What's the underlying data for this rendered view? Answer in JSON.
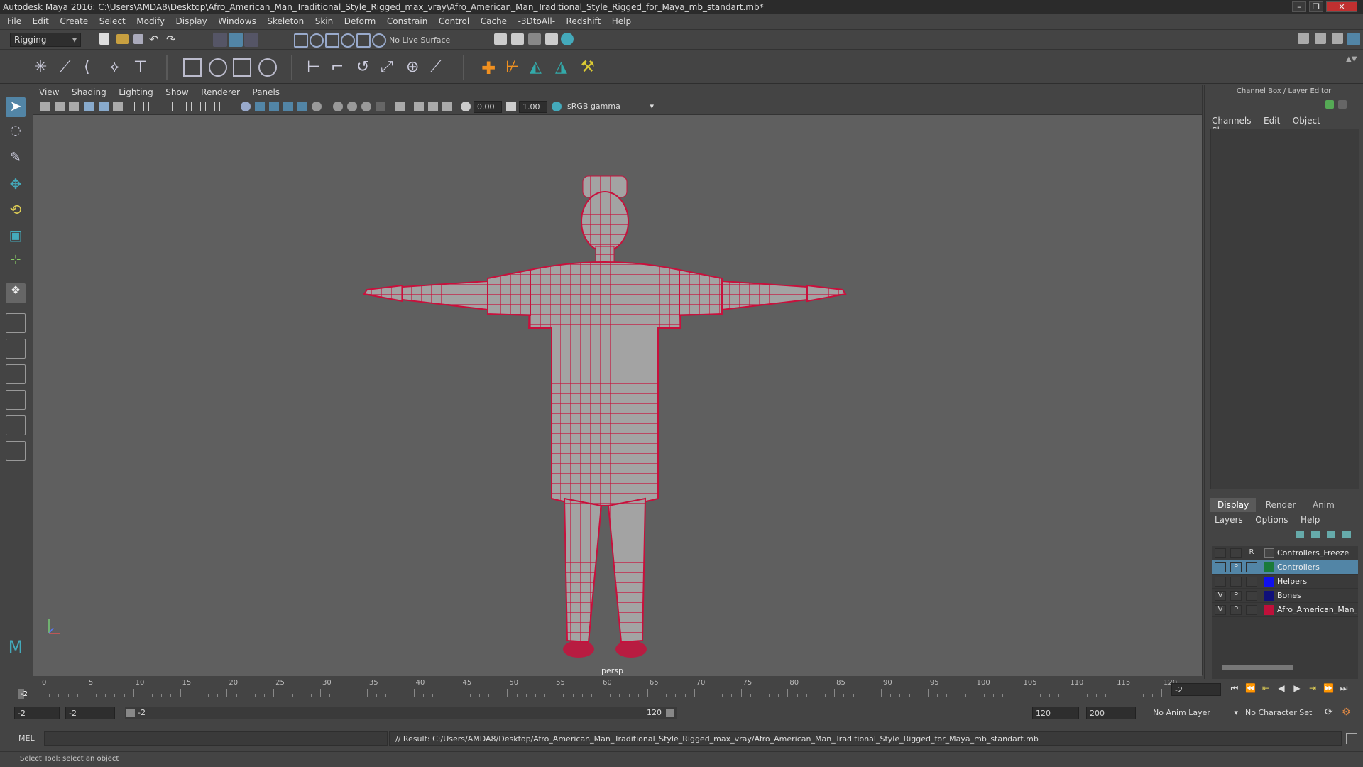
{
  "window": {
    "title": "Autodesk Maya 2016: C:\\Users\\AMDA8\\Desktop\\Afro_American_Man_Traditional_Style_Rigged_max_vray\\Afro_American_Man_Traditional_Style_Rigged_for_Maya_mb_standart.mb*",
    "controls": [
      "–",
      "❐",
      "✕"
    ]
  },
  "menubar": [
    "File",
    "Edit",
    "Create",
    "Select",
    "Modify",
    "Display",
    "Windows",
    "Skeleton",
    "Skin",
    "Deform",
    "Constrain",
    "Control",
    "Cache",
    "-3DtoAll-",
    "Redshift",
    "Help"
  ],
  "statusline": {
    "mode": "Rigging",
    "live_surface": "No Live Surface"
  },
  "viewport": {
    "menu": [
      "View",
      "Shading",
      "Lighting",
      "Show",
      "Renderer",
      "Panels"
    ],
    "exposure": "0.00",
    "gamma": "1.00",
    "color_space": "sRGB gamma",
    "camera": "persp"
  },
  "channel_box": {
    "title": "Channel Box / Layer Editor",
    "menu": [
      "Channels",
      "Edit",
      "Object",
      "Show"
    ],
    "tabs": [
      "Display",
      "Render",
      "Anim"
    ],
    "layer_menu": [
      "Layers",
      "Options",
      "Help"
    ],
    "layers": [
      {
        "v": "",
        "p": "",
        "r": "R",
        "name": "Controllers_Freeze",
        "color": "#444444",
        "selected": false
      },
      {
        "v": "",
        "p": "P",
        "r": "",
        "name": "Controllers",
        "color": "#1a7a3a",
        "selected": true
      },
      {
        "v": "",
        "p": "",
        "r": "",
        "name": "Helpers",
        "color": "#1010ee",
        "selected": false
      },
      {
        "v": "V",
        "p": "P",
        "r": "",
        "name": "Bones",
        "color": "#10107a",
        "selected": false
      },
      {
        "v": "V",
        "p": "P",
        "r": "",
        "name": "Afro_American_Man_Tr",
        "color": "#c0103a",
        "selected": false
      }
    ]
  },
  "timeline": {
    "ticks": [
      "0",
      "5",
      "10",
      "15",
      "20",
      "25",
      "30",
      "35",
      "40",
      "45",
      "50",
      "55",
      "60",
      "65",
      "70",
      "75",
      "80",
      "85",
      "90",
      "95",
      "100",
      "105",
      "110",
      "115",
      "120"
    ],
    "current_frame_marker": "-2",
    "current_frame": "-2"
  },
  "range": {
    "start": "-2",
    "playback_start": "-2",
    "slider_start": "-2",
    "slider_end": "120",
    "playback_end": "120",
    "end": "200",
    "anim_layer": "No Anim Layer",
    "character_set": "No Character Set"
  },
  "cmdline": {
    "lang": "MEL",
    "result": "// Result: C:/Users/AMDA8/Desktop/Afro_American_Man_Traditional_Style_Rigged_max_vray/Afro_American_Man_Traditional_Style_Rigged_for_Maya_mb_standart.mb"
  },
  "helpline": "Select Tool: select an object",
  "colors": {
    "wire": "#c8103c",
    "mesh": "#9a9a9a",
    "selection": "#5285a6"
  }
}
